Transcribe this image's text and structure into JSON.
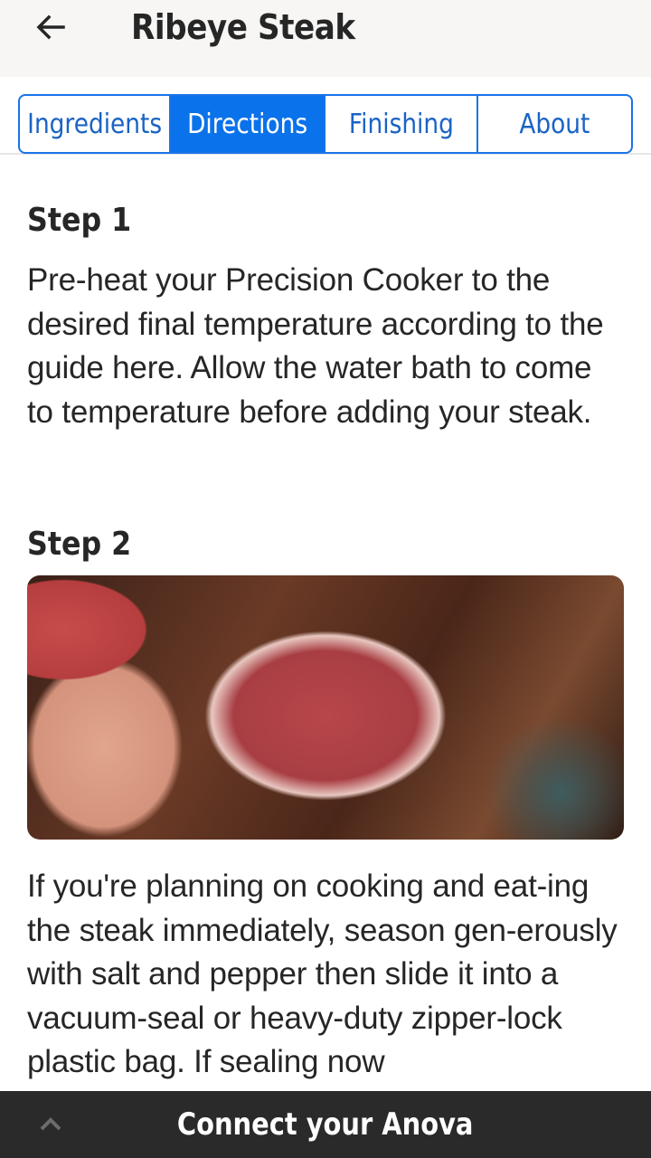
{
  "header": {
    "title": "Ribeye Steak",
    "back_icon": "arrow-left-icon"
  },
  "tabs": [
    {
      "label": "Ingredients",
      "active": false
    },
    {
      "label": "Directions",
      "active": true
    },
    {
      "label": "Finishing",
      "active": false
    },
    {
      "label": "About",
      "active": false
    }
  ],
  "colors": {
    "accent": "#0a72ea",
    "bottom_bar": "#2a2a2a",
    "header_bg": "#f7f6f4"
  },
  "steps": [
    {
      "title": "Step 1",
      "text": "Pre-heat your Precision Cooker to the desired final temperature according to the guide here. Allow the water bath to come to temperature before adding your steak."
    },
    {
      "title": "Step 2",
      "image": "Seasoned raw ribeye steak held by a hand on a wooden cutting board sprinkled with salt and pepper",
      "text": "If you're planning on cooking and eat-ing the steak immediately, season gen-erously with salt and pepper then slide it into a vacuum-seal or heavy-duty zipper-lock plastic bag. If sealing now"
    }
  ],
  "bottom_bar": {
    "label": "Connect your Anova",
    "icon": "chevron-up-icon"
  }
}
